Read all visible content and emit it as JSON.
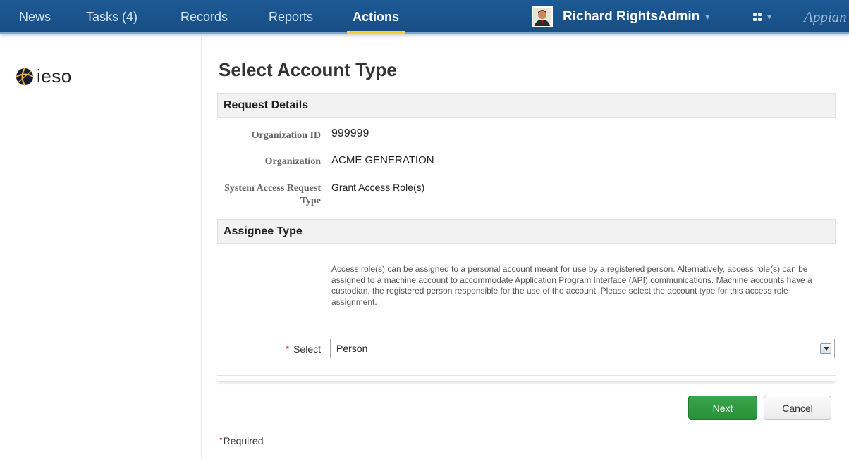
{
  "nav": {
    "tabs": [
      {
        "label": "News"
      },
      {
        "label": "Tasks (4)"
      },
      {
        "label": "Records"
      },
      {
        "label": "Reports"
      },
      {
        "label": "Actions"
      }
    ],
    "active_tab": "Actions",
    "user_name": "Richard RightsAdmin",
    "brand": "Appian"
  },
  "logo": {
    "text": "ieso"
  },
  "page": {
    "title": "Select Account Type"
  },
  "request_details": {
    "header": "Request Details",
    "fields": [
      {
        "label": "Organization ID",
        "value": "999999"
      },
      {
        "label": "Organization",
        "value": "ACME GENERATION"
      },
      {
        "label": "System Access Request Type",
        "value": "Grant Access Role(s)"
      }
    ]
  },
  "assignee_type": {
    "header": "Assignee Type",
    "help_text": "Access role(s) can be assigned to a personal account meant for use by a registered person. Alternatively, access role(s) can be assigned to a machine account to accommodate Application Program Interface (API) communications. Machine accounts have a custodian, the registered person responsible for the use of the account. Please select the account type for this access role assignment.",
    "select_label": "Select",
    "select_value": "Person"
  },
  "buttons": {
    "next": "Next",
    "cancel": "Cancel"
  },
  "required_note": "Required",
  "required_star": "*",
  "colors": {
    "nav_bg": "#1e5a96",
    "active_underline": "#f5d130",
    "next_button": "#2e9b40"
  },
  "icons": [
    "user-avatar-icon",
    "apps-grid-icon",
    "caret-down-icon",
    "ieso-globe-logo",
    "dropdown-arrow-icon"
  ]
}
